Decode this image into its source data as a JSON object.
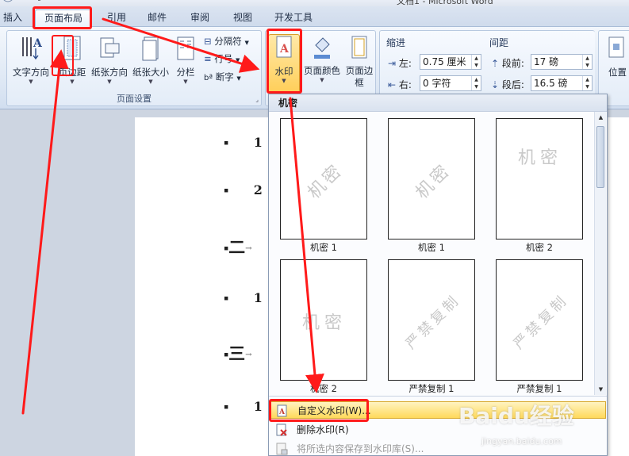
{
  "window": {
    "title": "文档1 - Microsoft Word"
  },
  "tabs": [
    "插入",
    "页面布局",
    "引用",
    "邮件",
    "审阅",
    "视图",
    "开发工具"
  ],
  "ribbon": {
    "page_setup": {
      "label": "页面设置",
      "text_direction": "文字方向",
      "margins": "页边距",
      "orientation": "纸张方向",
      "size": "纸张大小",
      "columns": "分栏",
      "breaks": "分隔符",
      "line_numbers": "行号",
      "hyphenation": "断字"
    },
    "page_background": {
      "watermark": "水印",
      "page_color": "页面颜色",
      "page_borders": "页面边框"
    },
    "paragraph": {
      "indent_title": "缩进",
      "indent_left_label": "左:",
      "indent_left_value": "0.75 厘米",
      "indent_right_label": "右:",
      "indent_right_value": "0 字符",
      "spacing_title": "间距",
      "before_label": "段前:",
      "before_value": "17 磅",
      "after_label": "段后:",
      "after_value": "16.5 磅"
    },
    "arrange": {
      "position": "位置"
    }
  },
  "document": {
    "lines": [
      {
        "bullet": "▪",
        "text": "1"
      },
      {
        "bullet": "▪",
        "text": "2"
      },
      {
        "bullet": "▪",
        "text": "二"
      },
      {
        "bullet": "▪",
        "text": "1"
      },
      {
        "bullet": "▪",
        "text": "三"
      },
      {
        "bullet": "▪",
        "text": "1"
      }
    ],
    "tab_mark": "→"
  },
  "watermark_gallery": {
    "header": "机密",
    "items": [
      {
        "caption": "机密 1",
        "text": "机密",
        "style": "diagonal"
      },
      {
        "caption": "机密 1",
        "text": "机密",
        "style": "diagonal"
      },
      {
        "caption": "机密 2",
        "text": "机密",
        "style": "horizontal"
      },
      {
        "caption": "机密 2",
        "text": "机密",
        "style": "horizontal"
      },
      {
        "caption": "严禁复制 1",
        "text": "严禁复制",
        "style": "diagonal"
      },
      {
        "caption": "严禁复制 1",
        "text": "严禁复制",
        "style": "diagonal"
      }
    ],
    "menu": {
      "custom": "自定义水印(W)...",
      "remove": "删除水印(R)",
      "save": "将所选内容保存到水印库(S)..."
    }
  },
  "brand_watermark": {
    "logo": "Baidu经验",
    "url": "jingyan.baidu.com"
  },
  "colors": {
    "annotation": "#ff1a1a",
    "highlight": "#ffd95a",
    "ribbon": "#dde7f4"
  }
}
